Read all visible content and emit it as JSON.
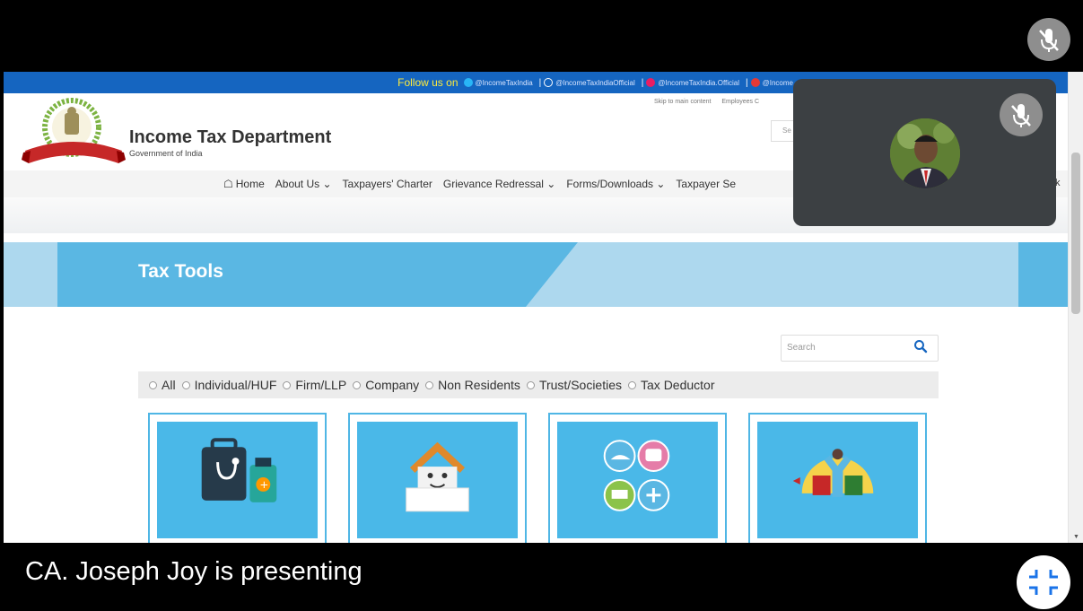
{
  "follow_bar": {
    "lead": "Follow us on",
    "handles": [
      {
        "label": "@IncomeTaxIndia",
        "color": "#29b6f6"
      },
      {
        "label": "@IncomeTaxIndiaOfficial",
        "color": "#1565c0"
      },
      {
        "label": "@IncomeTaxIndia.Official",
        "color": "#e91e63"
      },
      {
        "label": "@Income",
        "color": "#e53935"
      }
    ]
  },
  "header": {
    "title": "Income Tax Department",
    "subtitle": "Government of India",
    "top_links": [
      "Skip to main content",
      "Employees C"
    ],
    "search_placeholder": "Se",
    "emblem_ribbon": "INCOME TAX DEPARTMENT"
  },
  "nav": {
    "items": [
      "Home",
      "About Us ⌄",
      "Taxpayers' Charter",
      "Grievance Redressal ⌄",
      "Forms/Downloads ⌄",
      "Taxpayer Se"
    ],
    "extra": "k"
  },
  "banner": {
    "title": "Tax Tools"
  },
  "tools": {
    "search_placeholder": "Search",
    "filters": [
      "All",
      "Individual/HUF",
      "Firm/LLP",
      "Company",
      "Non Residents",
      "Trust/Societies",
      "Tax Deductor"
    ]
  },
  "meeting": {
    "presenting_text": "CA. Joseph Joy is presenting"
  },
  "colors": {
    "accent_blue": "#1565c0",
    "banner_blue": "#5ab7e3",
    "card_blue": "#4ab8e8"
  }
}
